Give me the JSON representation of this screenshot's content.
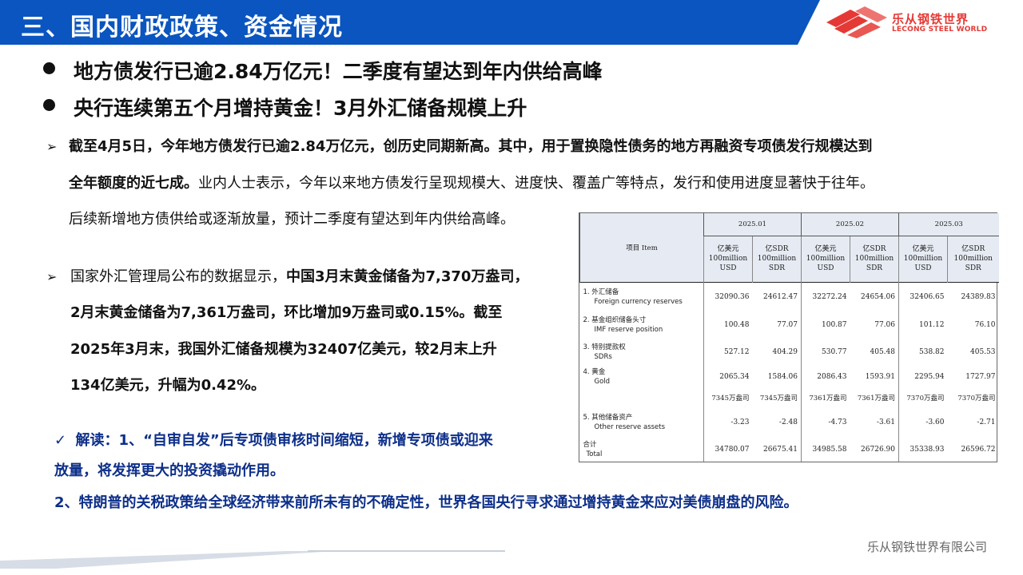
{
  "header": {
    "title": "三、国内财政政策、资金情况",
    "logo_cn": "乐从钢铁世界",
    "logo_en": "LECONG STEEL WORLD",
    "bar_color": "#0a55bf",
    "logo_color": "#e53935"
  },
  "headlines": [
    "地方债发行已逾2.84万亿元！二季度有望达到年内供给高峰",
    "央行连续第五个月增持黄金！3月外汇储备规模上升"
  ],
  "para1": {
    "line1": "截至4月5日，今年地方债发行已逾2.84万亿元，创历史同期新高。其中，用于置换隐性债务的地方再融资专项债发行规模达到",
    "line2_bold": "全年额度的近七成。",
    "line2_rest": "业内人士表示，今年以来地方债发行呈现规模大、进度快、覆盖广等特点，发行和使用进度显著快于往年。",
    "line3": "后续新增地方债供给或逐渐放量，预计二季度有望达到年内供给高峰。"
  },
  "para2": {
    "line1_normal": "国家外汇管理局公布的数据显示，",
    "line1_bold": "中国3月末黄金储备为7,370万盎司，",
    "line2": "2月末黄金储备为7,361万盎司，环比增加9万盎司或0.15%。截至",
    "line3": "2025年3月末，我国外汇储备规模为32407亿美元，较2月末上升",
    "line4": "134亿美元，升幅为0.42%。"
  },
  "interpretation": {
    "check": "✓",
    "line1": "解读：1、“自审自发”后专项债审核时间缩短，新增专项债或迎来",
    "line2": "放量，将发挥更大的投资撬动作用。",
    "line3": "2、特朗普的关税政策给全球经济带来前所未有的不确定性，世界各国央行寻求通过增持黄金来应对美债崩盘的风险。",
    "color": "#0d2f8a"
  },
  "footer": {
    "company": "乐从钢铁世界有限公司"
  },
  "table": {
    "item_header": "项目 Item",
    "months": [
      "2025.01",
      "2025.02",
      "2025.03"
    ],
    "unit_usd": [
      "亿美元",
      "100million",
      "USD"
    ],
    "unit_sdr": [
      "亿SDR",
      "100million",
      "SDR"
    ],
    "rows": [
      {
        "cn": "1. 外汇储备",
        "en": "Foreign currency reserves",
        "values": [
          "32090.36",
          "24612.47",
          "32272.24",
          "24654.06",
          "32406.65",
          "24389.83"
        ]
      },
      {
        "cn": "2. 基金组织储备头寸",
        "en": "IMF reserve position",
        "values": [
          "100.48",
          "77.07",
          "100.87",
          "77.06",
          "101.12",
          "76.10"
        ]
      },
      {
        "cn": "3. 特别提款权",
        "en": "SDRs",
        "values": [
          "527.12",
          "404.29",
          "530.77",
          "405.48",
          "538.82",
          "405.53"
        ]
      },
      {
        "cn": "4. 黄金",
        "en": "Gold",
        "values": [
          "2065.34",
          "1584.06",
          "2086.43",
          "1593.91",
          "2295.94",
          "1727.97"
        ]
      },
      {
        "cn": "",
        "en": "",
        "values": [
          "7345万盎司",
          "7345万盎司",
          "7361万盎司",
          "7361万盎司",
          "7370万盎司",
          "7370万盎司"
        ]
      },
      {
        "cn": "5. 其他储备资产",
        "en": "Other reserve assets",
        "values": [
          "-3.23",
          "-2.48",
          "-4.73",
          "-3.61",
          "-3.60",
          "-2.71"
        ]
      },
      {
        "cn": "合计",
        "en": "Total",
        "values": [
          "34780.07",
          "26675.41",
          "34985.58",
          "26726.90",
          "35338.93",
          "26596.72"
        ]
      }
    ]
  }
}
